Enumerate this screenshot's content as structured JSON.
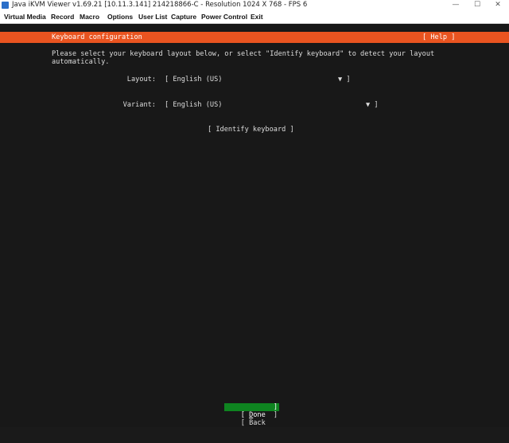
{
  "window": {
    "title": "Java iKVM Viewer v1.69.21 [10.11.3.141] 214218866-C - Resolution 1024 X 768 - FPS 6",
    "controls": [
      "—",
      "☐",
      "✕"
    ]
  },
  "menubar": {
    "items": [
      "Virtual Media",
      "Record",
      "Macro",
      "Options",
      "User List",
      "Capture",
      "Power Control",
      "Exit"
    ]
  },
  "installer": {
    "header_title": "Keyboard configuration",
    "help_label": "[ Help ]",
    "instructions": [
      "Please select your keyboard layout below, or select \"Identify keyboard\" to detect your layout",
      "automatically."
    ],
    "layout": {
      "label": "Layout:",
      "value": "[ English (US)",
      "arrow": "▼ ]"
    },
    "variant": {
      "label": "Variant:",
      "value": "[ English (US)",
      "arrow": "▼ ]"
    },
    "identify_label": "[ Identify keyboard ]",
    "done": {
      "open": "[ ",
      "hotkey": "D",
      "rest": "one",
      "close": "]"
    },
    "back": {
      "open": "[ ",
      "label": "Back",
      "close": "]"
    }
  },
  "colors": {
    "header": "#e95420",
    "done_highlight": "#0e8420",
    "console_bg": "#181818"
  }
}
